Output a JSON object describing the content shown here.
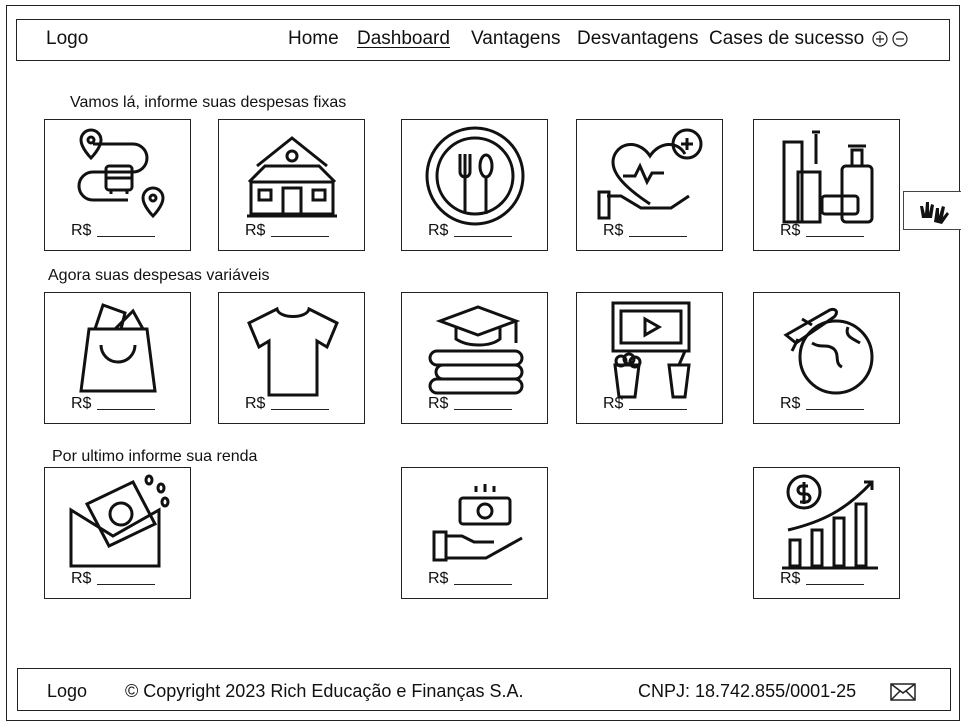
{
  "header": {
    "logo": "Logo",
    "nav": [
      "Home",
      "Dashboard",
      "Vantagens",
      "Desvantagens",
      "Cases de sucesso"
    ],
    "active_nav": "Dashboard"
  },
  "sections": {
    "fixed_title": "Vamos lá, informe suas despesas fixas",
    "variable_title": "Agora suas despesas variáveis",
    "income_title": "Por ultimo informe sua renda"
  },
  "currency_label": "R$",
  "fixed_cards": [
    "transport-icon",
    "house-icon",
    "food-plate-icon",
    "health-heart-icon",
    "hygiene-products-icon"
  ],
  "variable_cards": [
    "shopping-bag-icon",
    "tshirt-icon",
    "education-books-icon",
    "cinema-popcorn-icon",
    "travel-globe-icon"
  ],
  "income_cards": [
    "money-envelope-icon",
    "hand-money-icon",
    "growth-chart-icon"
  ],
  "footer": {
    "logo": "Logo",
    "copyright": "© Copyright 2023 Rich Educação e Finanças S.A.",
    "cnpj": "CNPJ: 18.742.855/0001-25"
  }
}
